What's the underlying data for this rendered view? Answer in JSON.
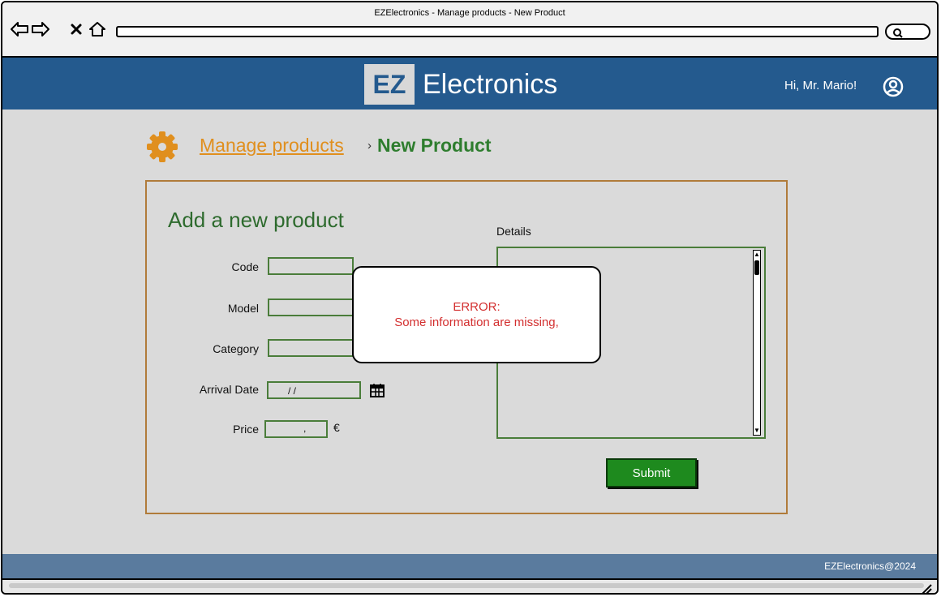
{
  "window": {
    "title": "EZElectronics - Manage products - New Product"
  },
  "header": {
    "logo_mark": "EZ",
    "logo_text": "Electronics",
    "greeting": "Hi, Mr. Mario!"
  },
  "breadcrumb": {
    "parent": "Manage products",
    "separator": "›",
    "current": "New Product"
  },
  "form": {
    "title": "Add a new product",
    "labels": {
      "code": "Code",
      "model": "Model",
      "category": "Category",
      "arrival_date": "Arrival Date",
      "price": "Price",
      "details": "Details"
    },
    "arrival_date_value": "/      /",
    "price_value": ",",
    "currency": "€",
    "submit_label": "Submit"
  },
  "error": {
    "title": "ERROR:",
    "message": "Some information are missing,"
  },
  "footer": {
    "text": "EZElectronics@2024"
  },
  "colors": {
    "header": "#245a8e",
    "link": "#e08f1e",
    "current": "#2e7d2e",
    "error": "#d32f2f",
    "submit": "#1e8a1e"
  },
  "icons": [
    "back-arrow-icon",
    "forward-arrow-icon",
    "close-icon",
    "home-icon",
    "search-icon",
    "user-icon",
    "gear-icon",
    "calendar-icon",
    "resize-icon"
  ]
}
